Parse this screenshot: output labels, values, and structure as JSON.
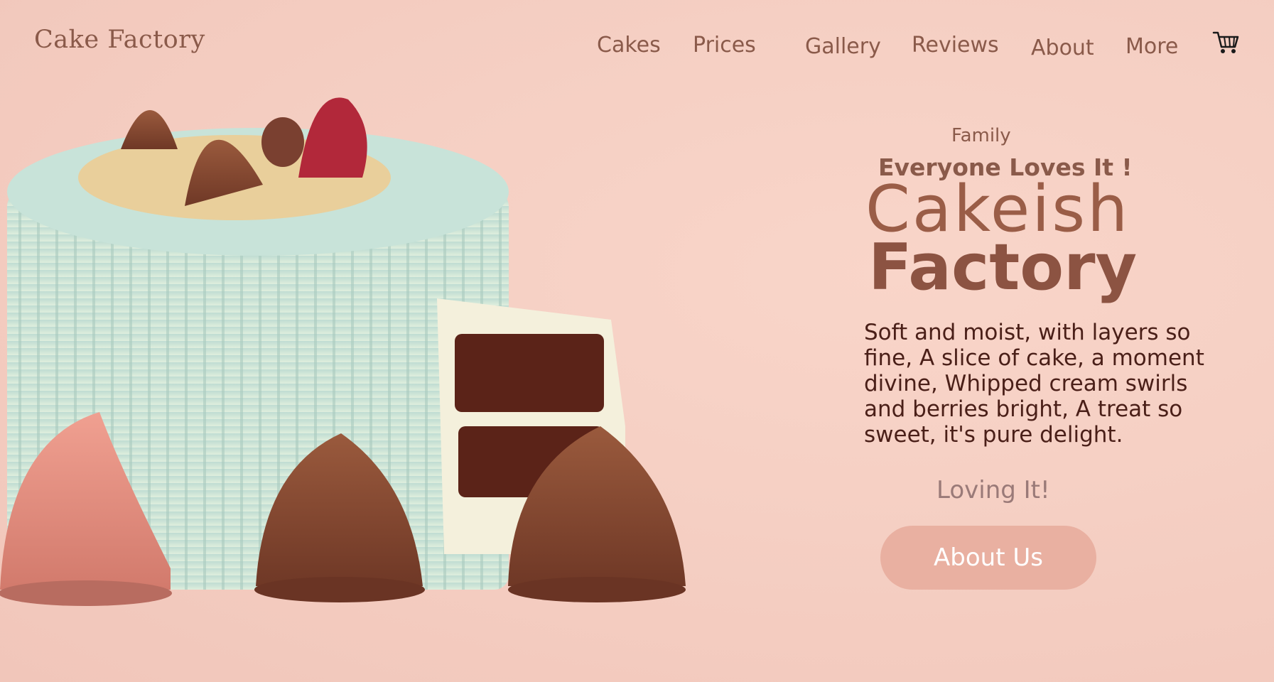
{
  "header": {
    "logo": "Cake Factory",
    "nav": [
      {
        "label": "Cakes"
      },
      {
        "label": "Prices"
      },
      {
        "label": "Gallery"
      },
      {
        "label": "Reviews"
      },
      {
        "label": "About"
      },
      {
        "label": "More"
      }
    ],
    "cart_icon": "cart-icon"
  },
  "hero": {
    "eyebrow_small": "Family",
    "eyebrow_strong": "Everyone Loves It !",
    "title_line1": "Cakeish",
    "title_line2": "Factory",
    "description": "Soft and moist, with layers so fine, A slice of cake, a moment divine, Whipped cream swirls and berries bright, A treat so sweet, it's pure delight.",
    "loving": "Loving It!",
    "cta_label": "About Us"
  },
  "colors": {
    "background": "#f5cfc3",
    "accent_text": "#8a5a4a",
    "button": "#e9b0a1"
  }
}
